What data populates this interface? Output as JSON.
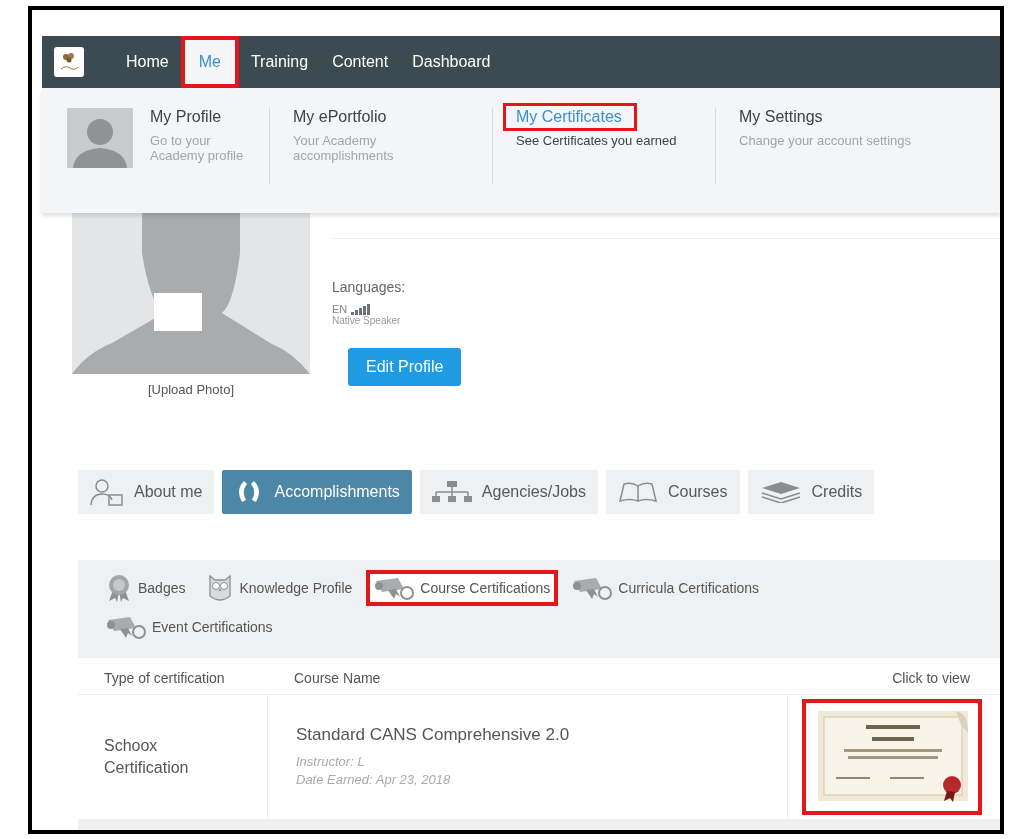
{
  "nav": [
    {
      "label": "Home",
      "selected": false,
      "highlighted": false
    },
    {
      "label": "Me",
      "selected": true,
      "highlighted": true
    },
    {
      "label": "Training",
      "selected": false,
      "highlighted": false
    },
    {
      "label": "Content",
      "selected": false,
      "highlighted": false
    },
    {
      "label": "Dashboard",
      "selected": false,
      "highlighted": false
    }
  ],
  "menu": [
    {
      "kind": "avatar",
      "title": "My Profile",
      "description": "Go to your Academy profile",
      "selected": false,
      "highlighted": false
    },
    {
      "kind": "text",
      "title": "My ePortfolio",
      "description": "Your Academy accomplishments",
      "selected": false,
      "highlighted": false
    },
    {
      "kind": "text",
      "title": "My Certificates",
      "description": "See Certificates you earned",
      "selected": true,
      "highlighted": true
    },
    {
      "kind": "text",
      "title": "My Settings",
      "description": "Change your account settings",
      "selected": false,
      "highlighted": false
    }
  ],
  "profile": {
    "upload_label": "[Upload Photo]",
    "languages_label": "Languages:",
    "languages": [
      {
        "code": "EN",
        "note": "Native Speaker"
      }
    ],
    "edit_button": "Edit Profile"
  },
  "tabs": [
    {
      "kind": "person",
      "label": "About me",
      "selected": false
    },
    {
      "kind": "wreath",
      "label": "Accomplishments",
      "selected": true
    },
    {
      "kind": "org",
      "label": "Agencies/Jobs",
      "selected": false
    },
    {
      "kind": "book",
      "label": "Courses",
      "selected": false
    },
    {
      "kind": "stack",
      "label": "Credits",
      "selected": false
    }
  ],
  "subtabs": [
    {
      "kind": "medal",
      "label": "Badges",
      "highlighted": false
    },
    {
      "kind": "owl",
      "label": "Knowledge Profile",
      "highlighted": false
    },
    {
      "kind": "scroll",
      "label": "Course Certifications",
      "highlighted": true
    },
    {
      "kind": "scroll",
      "label": "Curricula Certifications",
      "highlighted": false
    },
    {
      "kind": "scroll",
      "label": "Event Certifications",
      "highlighted": false
    }
  ],
  "table": {
    "columns": [
      "Type of certification",
      "Course Name",
      "Click to view"
    ],
    "rows": [
      {
        "type": "Schoox Certification",
        "course": "Standard CANS Comprehensive 2.0",
        "instructor": "Instructor: L",
        "date": "Date Earned: Apr 23, 2018",
        "thumbnail": {
          "kind": "picture",
          "highlighted": true
        }
      }
    ]
  }
}
